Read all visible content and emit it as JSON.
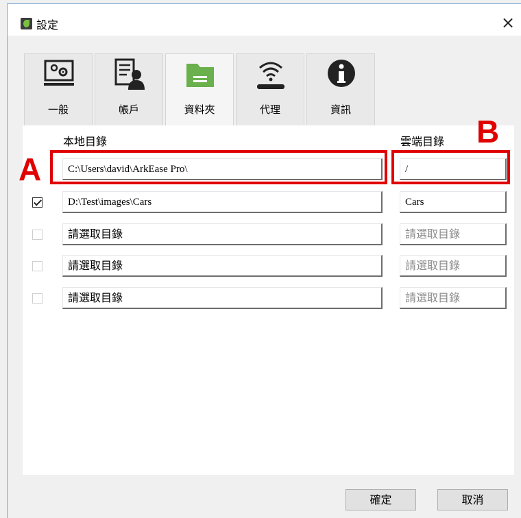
{
  "window": {
    "title": "設定",
    "close_symbol": "×"
  },
  "tabs": [
    {
      "label": "一般",
      "icon": "monitor-settings-icon"
    },
    {
      "label": "帳戶",
      "icon": "user-account-icon"
    },
    {
      "label": "資料夾",
      "icon": "folder-icon",
      "active": true
    },
    {
      "label": "代理",
      "icon": "proxy-wifi-icon"
    },
    {
      "label": "資訊",
      "icon": "info-icon"
    }
  ],
  "columns": {
    "local": "本地目錄",
    "cloud": "雲端目錄"
  },
  "rows": [
    {
      "checked": null,
      "local": "C:\\Users\\david\\ArkEase Pro\\",
      "cloud": "/"
    },
    {
      "checked": true,
      "local": "D:\\Test\\images\\Cars",
      "cloud": "Cars"
    },
    {
      "checked": false,
      "local": "請選取目錄",
      "cloud": "請選取目錄"
    },
    {
      "checked": false,
      "local": "請選取目錄",
      "cloud": "請選取目錄"
    },
    {
      "checked": false,
      "local": "請選取目錄",
      "cloud": "請選取目錄"
    }
  ],
  "annotations": {
    "a": "A",
    "b": "B",
    "color": "#e00000"
  },
  "buttons": {
    "ok": "確定",
    "cancel": "取消"
  },
  "colors": {
    "active_tab_green": "#6ab04c",
    "highlight": "#e00000"
  }
}
